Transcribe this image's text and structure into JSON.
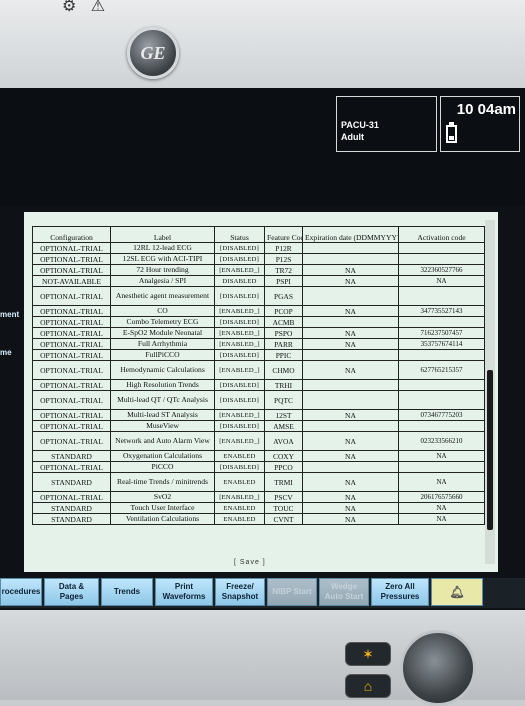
{
  "device": {
    "top_icons": [
      "⚙",
      "⚠"
    ],
    "logo_text": "GE"
  },
  "header": {
    "bed_name": "PACU-31",
    "patient_category": "Adult",
    "time": "10 04am"
  },
  "side_labels": [
    "ment",
    "me"
  ],
  "table": {
    "columns": [
      "Configuration",
      "Label",
      "Status",
      "Feature Code",
      "Expiration date (DDMMYYYY)",
      "Activation code"
    ],
    "rows": [
      [
        "OPTIONAL-TRIAL",
        "12RL 12-lead ECG",
        "[DISABLED]",
        "P12R",
        "",
        ""
      ],
      [
        "OPTIONAL-TRIAL",
        "12SL ECG with ACI-TIPI",
        "[DISABLED]",
        "P12S",
        "",
        ""
      ],
      [
        "OPTIONAL-TRIAL",
        "72 Hour trending",
        "[ENABLED_]",
        "TR72",
        "NA",
        "322360527766"
      ],
      [
        "NOT-AVAILABLE",
        "Analgesia / SPI",
        "DISABLED",
        "PSPI",
        "NA",
        "NA"
      ],
      [
        "OPTIONAL-TRIAL",
        "Anesthetic agent measurement",
        "[DISABLED]",
        "PGAS",
        "",
        ""
      ],
      [
        "OPTIONAL-TRIAL",
        "CO",
        "[ENABLED_]",
        "PCOP",
        "NA",
        "347735527143"
      ],
      [
        "OPTIONAL-TRIAL",
        "Combo Telemetry ECG",
        "[DISABLED]",
        "ACMB",
        "",
        ""
      ],
      [
        "OPTIONAL-TRIAL",
        "E-SpO2 Module Neonatal",
        "[ENABLED_]",
        "PSPO",
        "NA",
        "716237507457"
      ],
      [
        "OPTIONAL-TRIAL",
        "Full Arrhythmia",
        "[ENABLED_]",
        "PARR",
        "NA",
        "353757674114"
      ],
      [
        "OPTIONAL-TRIAL",
        "FullPiCCO",
        "[DISABLED]",
        "PPIC",
        "",
        ""
      ],
      [
        "OPTIONAL-TRIAL",
        "Hemodynamic Calculations",
        "[ENABLED_]",
        "CHMO",
        "NA",
        "627765215357"
      ],
      [
        "OPTIONAL-TRIAL",
        "High Resolution Trends",
        "[DISABLED]",
        "TRHI",
        "",
        ""
      ],
      [
        "OPTIONAL-TRIAL",
        "Multi-lead QT / QTc Analysis",
        "[DISABLED]",
        "PQTC",
        "",
        ""
      ],
      [
        "OPTIONAL-TRIAL",
        "Multi-lead ST Analysis",
        "[ENABLED_]",
        "12ST",
        "NA",
        "073467775203"
      ],
      [
        "OPTIONAL-TRIAL",
        "MuseView",
        "[DISABLED]",
        "AMSE",
        "",
        ""
      ],
      [
        "OPTIONAL-TRIAL",
        "Network and Auto Alarm View",
        "[ENABLED_]",
        "AVOA",
        "NA",
        "023233566210"
      ],
      [
        "STANDARD",
        "Oxygenation Calculations",
        "ENABLED",
        "COXY",
        "NA",
        "NA"
      ],
      [
        "OPTIONAL-TRIAL",
        "PiCCO",
        "[DISABLED]",
        "PPCO",
        "",
        ""
      ],
      [
        "STANDARD",
        "Real-time Trends / minitrends",
        "ENABLED",
        "TRMI",
        "NA",
        "NA"
      ],
      [
        "OPTIONAL-TRIAL",
        "SvO2",
        "[ENABLED_]",
        "PSCV",
        "NA",
        "206176575660"
      ],
      [
        "STANDARD",
        "Touch User Interface",
        "ENABLED",
        "TOUC",
        "NA",
        "NA"
      ],
      [
        "STANDARD",
        "Ventilation Calculations",
        "ENABLED",
        "CVNT",
        "NA",
        "NA"
      ]
    ],
    "tall_rows": [
      4,
      10,
      12,
      15,
      18
    ]
  },
  "save_label": "[ Save ]",
  "menu": {
    "procedures": "rocedures",
    "data_pages": "Data & Pages",
    "trends": "Trends",
    "print_waveforms": "Print Waveforms",
    "freeze_snapshot": "Freeze/ Snapshot",
    "disabled1": "NIBP Start",
    "disabled2": "Wedge Auto Start",
    "zero_all": "Zero All Pressures",
    "alarm_icon": "bell-icon"
  }
}
